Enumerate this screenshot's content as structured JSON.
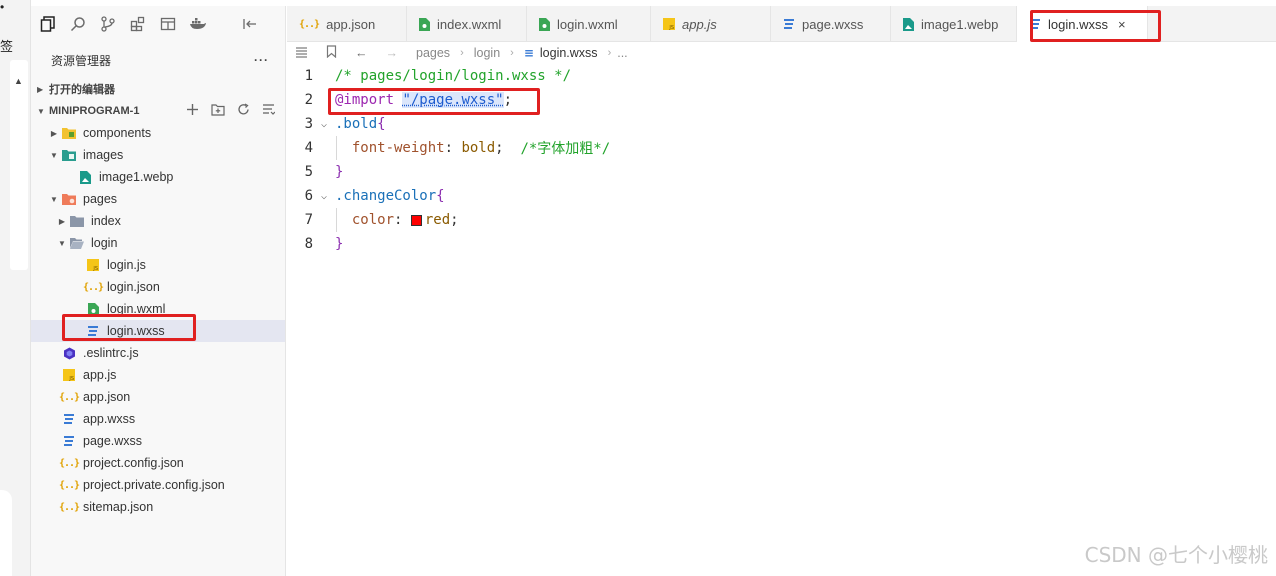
{
  "outer": {
    "char_top": "•",
    "char_side": "签"
  },
  "activity_bar": {
    "icons": [
      "files-icon",
      "search-icon",
      "source-control-icon",
      "extensions-icon",
      "debug-icon",
      "docker-icon",
      "split-icon"
    ]
  },
  "explorer": {
    "title": "资源管理器",
    "more": "···",
    "open_editors_label": "打开的编辑器",
    "project_label": "MINIPROGRAM-1",
    "tree": [
      {
        "label": "components",
        "icon": "folder-components-icon",
        "depth": 0,
        "twisty": "closed"
      },
      {
        "label": "images",
        "icon": "folder-images-icon",
        "depth": 0,
        "twisty": "open"
      },
      {
        "label": "image1.webp",
        "icon": "image-file-icon",
        "depth": 1,
        "twisty": "none"
      },
      {
        "label": "pages",
        "icon": "folder-pages-icon",
        "depth": 0,
        "twisty": "open"
      },
      {
        "label": "index",
        "icon": "folder-icon",
        "depth": 1,
        "twisty": "closed"
      },
      {
        "label": "login",
        "icon": "folder-open-icon",
        "depth": 1,
        "twisty": "open"
      },
      {
        "label": "login.js",
        "icon": "js-file-icon",
        "depth": 2,
        "twisty": "none"
      },
      {
        "label": "login.json",
        "icon": "json-file-icon",
        "depth": 2,
        "twisty": "none"
      },
      {
        "label": "login.wxml",
        "icon": "wxml-file-icon",
        "depth": 2,
        "twisty": "none"
      },
      {
        "label": "login.wxss",
        "icon": "wxss-file-icon",
        "depth": 2,
        "twisty": "none",
        "selected": true
      },
      {
        "label": ".eslintrc.js",
        "icon": "eslint-file-icon",
        "depth": 0,
        "twisty": "none"
      },
      {
        "label": "app.js",
        "icon": "js-file-icon",
        "depth": 0,
        "twisty": "none"
      },
      {
        "label": "app.json",
        "icon": "json-file-icon",
        "depth": 0,
        "twisty": "none"
      },
      {
        "label": "app.wxss",
        "icon": "wxss-file-icon",
        "depth": 0,
        "twisty": "none"
      },
      {
        "label": "page.wxss",
        "icon": "wxss-file-icon",
        "depth": 0,
        "twisty": "none"
      },
      {
        "label": "project.config.json",
        "icon": "json-file-icon",
        "depth": 0,
        "twisty": "none"
      },
      {
        "label": "project.private.config.json",
        "icon": "json-file-icon",
        "depth": 0,
        "twisty": "none"
      },
      {
        "label": "sitemap.json",
        "icon": "json-file-icon",
        "depth": 0,
        "twisty": "none"
      }
    ]
  },
  "tabs": [
    {
      "label": "app.json",
      "icon": "json-file-icon"
    },
    {
      "label": "index.wxml",
      "icon": "wxml-file-icon"
    },
    {
      "label": "login.wxml",
      "icon": "wxml-file-icon"
    },
    {
      "label": "app.js",
      "icon": "js-file-icon",
      "italic": true
    },
    {
      "label": "page.wxss",
      "icon": "wxss-file-icon"
    },
    {
      "label": "image1.webp",
      "icon": "image-file-icon"
    },
    {
      "label": "login.wxss",
      "icon": "wxss-file-icon",
      "active": true,
      "close": "×"
    }
  ],
  "breadcrumb": {
    "items": [
      "pages",
      "login",
      "login.wxss",
      "..."
    ]
  },
  "editor": {
    "line_numbers": [
      "1",
      "2",
      "3",
      "4",
      "5",
      "6",
      "7",
      "8"
    ],
    "lines": {
      "l1": "/* pages/login/login.wxss */",
      "l2_at": "@import",
      "l2_str": "\"/page.wxss\"",
      "l2_end": ";",
      "l3_sel": ".bold",
      "l3_brace": "{",
      "l4_prop": "font-weight",
      "l4_colon": ": ",
      "l4_val": "bold",
      "l4_semi": ";",
      "l4_comment": "/*字体加粗*/",
      "l5_brace": "}",
      "l6_sel": ".changeColor",
      "l6_brace": "{",
      "l7_prop": "color",
      "l7_colon": ": ",
      "l7_val": "red",
      "l7_semi": ";",
      "l8_brace": "}"
    },
    "color_swatch": "#ff0000"
  },
  "watermark": "CSDN @七个小樱桃"
}
